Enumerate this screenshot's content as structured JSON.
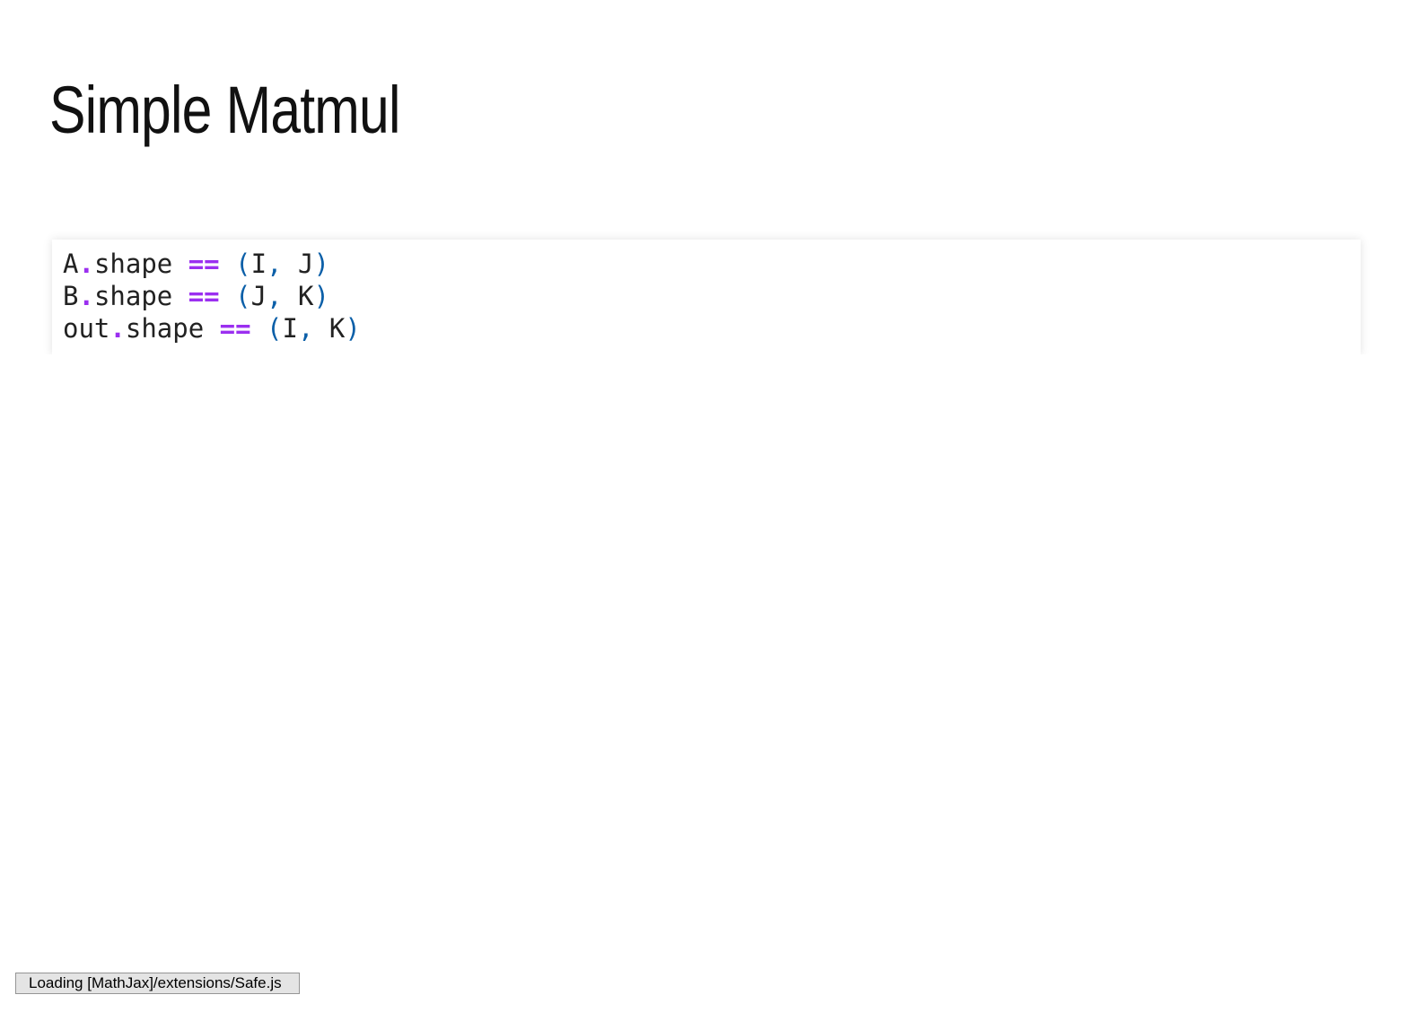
{
  "slide": {
    "title": "Simple Matmul"
  },
  "code": {
    "lines": [
      {
        "obj": "A",
        "dot": ".",
        "attr": "shape",
        "op": "==",
        "open": "(",
        "a": "I",
        "comma": ",",
        "b": "J",
        "close": ")"
      },
      {
        "obj": "B",
        "dot": ".",
        "attr": "shape",
        "op": "==",
        "open": "(",
        "a": "J",
        "comma": ",",
        "b": "K",
        "close": ")"
      },
      {
        "obj": "out",
        "dot": ".",
        "attr": "shape",
        "op": "==",
        "open": "(",
        "a": "I",
        "comma": ",",
        "b": "K",
        "close": ")"
      }
    ],
    "colors": {
      "operator": "#9b2ff0",
      "punctuation": "#0b5fa8",
      "text": "#222222"
    }
  },
  "status": {
    "message": "Loading [MathJax]/extensions/Safe.js"
  }
}
